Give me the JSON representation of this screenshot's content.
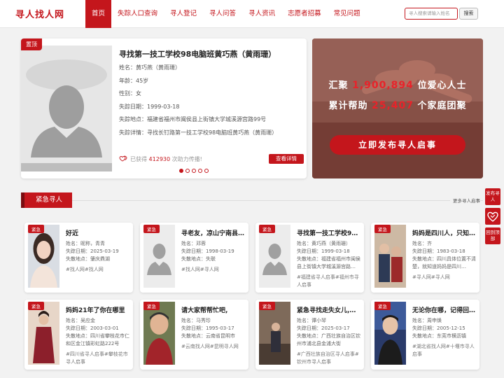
{
  "header": {
    "logo": "寻人找人网",
    "nav": [
      "首页",
      "失踪人口查询",
      "寻人登记",
      "寻人问答",
      "寻人资讯",
      "志愿者招募",
      "常见问题"
    ],
    "search_placeholder": "寻人搜索请输入姓名",
    "search_button": "搜索"
  },
  "featured": {
    "badge": "置顶",
    "title": "寻找第一技工学校98电脑班黄巧燕（黄雨珊）",
    "rows": [
      "姓名：黄巧燕（黄雨珊）",
      "年龄：45岁",
      "性别：女",
      "失踪日期：1999-03-18",
      "失踪地点：福建省福州市闽侯县上街镇大学城溪源宫路99号",
      "失踪详情：寻找长钉路第一技工学校98电脑班黄巧燕（黄雨珊）"
    ],
    "help_prefix": "已获得",
    "help_count": "412930",
    "help_suffix": "次助力传播!",
    "detail_button": "查看详情",
    "slide_count": 5,
    "active_slide": 0
  },
  "banner": {
    "line1_prefix": "汇聚",
    "line1_num": "1,900,894",
    "line1_suffix": "位爱心人士",
    "line2_prefix": "累计帮助",
    "line2_num": "25,407",
    "line2_suffix": "个家庭团聚",
    "button": "立即发布寻人启事"
  },
  "urgent": {
    "title": "紧急寻人",
    "more": "更多寻人启事"
  },
  "cards": [
    {
      "badge": "紧急",
      "title": "好近",
      "name": "姓名：昵称，青青",
      "date": "失踪日期：2025-03-19",
      "place": "失散地点：肇庆鼎湖",
      "tags": "#找人网#找人网",
      "photo": "girl"
    },
    {
      "badge": "紧急",
      "title": "寻老友，凉山宁南县…",
      "name": "姓名：邓蓉",
      "date": "失踪日期：1998-03-19",
      "place": "失散地点：失联",
      "tags": "#找人网#寻人网",
      "photo": "placeholder"
    },
    {
      "badge": "紧急",
      "title": "寻找第一技工学校98…",
      "name": "姓名：黄巧燕（黄雨珊）",
      "date": "失踪日期：1999-03-18",
      "place": "失散地点：福建省福州市闽侯县上街镇大学城溪源宫路…",
      "tags": "#福建省寻人启事#福州市寻人启事",
      "photo": "placeholder"
    },
    {
      "badge": "紧急",
      "title": "妈妈是四川人，只知…",
      "name": "姓名：齐",
      "date": "失踪日期：1983-03-18",
      "place": "失散地点：四川具体位置不清楚，就知道妈妈是四川…",
      "tags": "#寻人网#寻人网",
      "photo": "family"
    },
    {
      "badge": "紧急",
      "title": "妈妈21年了你在哪里",
      "name": "姓名：吴应金",
      "date": "失踪日期：2003-03-01",
      "place": "失散地点：四川省攀枝花市仁和区金江镇彩虹路222号",
      "tags": "#四川省寻人启事#攀枝花市寻人启事",
      "photo": "woman"
    },
    {
      "badge": "紧急",
      "title": "请大家帮帮忙吧,",
      "name": "姓名：马秀珍",
      "date": "失踪日期：1995-03-17",
      "place": "失散地点：云南省昆明市",
      "tags": "#云南找人网#昆明寻人网",
      "photo": "elder"
    },
    {
      "badge": "紧急",
      "title": "紧急寻找走失女儿,…",
      "name": "姓名：谭小琴",
      "date": "失踪日期：2025-03-17",
      "place": "失散地点：广西壮族自治区钦州市浦北县金浦大街",
      "tags": "#广西壮族自治区寻人启事#钦州市寻人启事",
      "photo": "room"
    },
    {
      "badge": "紧急",
      "title": "无论你在哪，记得回…",
      "name": "姓名：周申焕",
      "date": "失踪日期：2005-12-15",
      "place": "失散地点：东莞市横沥镇",
      "tags": "#湖北省找人网#十堰市寻人启事",
      "photo": "boy"
    }
  ],
  "side": {
    "publish": "发布寻人",
    "top": "回到顶部"
  },
  "colors": {
    "brand": "#c4161c",
    "background": "#f2f2f2"
  }
}
